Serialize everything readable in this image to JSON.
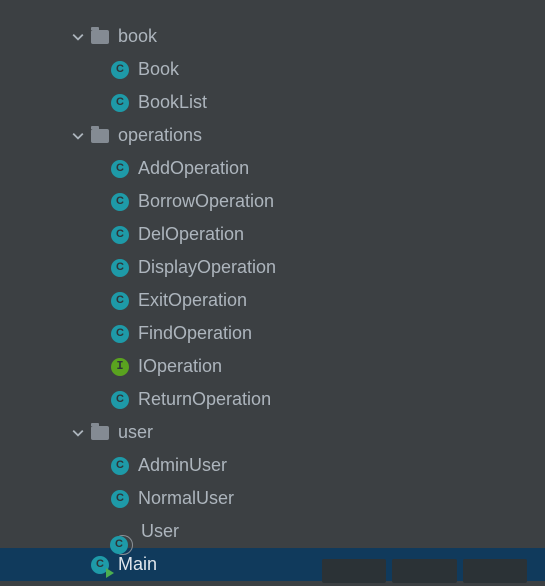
{
  "tree": {
    "packages": [
      {
        "name": "book",
        "expanded": true,
        "items": [
          {
            "name": "Book",
            "kind": "class"
          },
          {
            "name": "BookList",
            "kind": "class"
          }
        ]
      },
      {
        "name": "operations",
        "expanded": true,
        "items": [
          {
            "name": "AddOperation",
            "kind": "class"
          },
          {
            "name": "BorrowOperation",
            "kind": "class"
          },
          {
            "name": "DelOperation",
            "kind": "class"
          },
          {
            "name": "DisplayOperation",
            "kind": "class"
          },
          {
            "name": "ExitOperation",
            "kind": "class"
          },
          {
            "name": "FindOperation",
            "kind": "class"
          },
          {
            "name": "IOperation",
            "kind": "interface"
          },
          {
            "name": "ReturnOperation",
            "kind": "class"
          }
        ]
      },
      {
        "name": "user",
        "expanded": true,
        "items": [
          {
            "name": "AdminUser",
            "kind": "class"
          },
          {
            "name": "NormalUser",
            "kind": "class"
          },
          {
            "name": "User",
            "kind": "abstract-class"
          }
        ]
      }
    ],
    "root_item": {
      "name": "Main",
      "kind": "class-runnable",
      "selected": true
    }
  },
  "letters": {
    "class": "C",
    "interface": "I"
  }
}
